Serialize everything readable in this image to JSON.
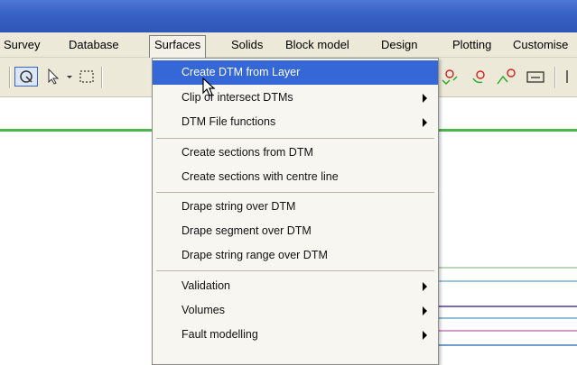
{
  "menubar": {
    "items": [
      "Survey",
      "Database",
      "Surfaces",
      "Solids",
      "Block model",
      "Design",
      "Plotting",
      "Customise"
    ],
    "active": "Surfaces"
  },
  "dropdown": {
    "items": [
      {
        "label": "Create DTM from Layer",
        "highlighted": true,
        "submenu": false
      },
      {
        "label": "Clip or intersect DTMs",
        "highlighted": false,
        "submenu": true
      },
      {
        "label": "DTM File functions",
        "highlighted": false,
        "submenu": true
      },
      {
        "label": "Create sections from DTM",
        "highlighted": false,
        "submenu": false
      },
      {
        "label": "Create sections with centre line",
        "highlighted": false,
        "submenu": false
      },
      {
        "label": "Drape string over DTM",
        "highlighted": false,
        "submenu": false
      },
      {
        "label": "Drape segment over DTM",
        "highlighted": false,
        "submenu": false
      },
      {
        "label": "Drape string range over DTM",
        "highlighted": false,
        "submenu": false
      },
      {
        "label": "Validation",
        "highlighted": false,
        "submenu": true
      },
      {
        "label": "Volumes",
        "highlighted": false,
        "submenu": true
      },
      {
        "label": "Fault modelling",
        "highlighted": false,
        "submenu": true
      }
    ]
  },
  "icons": {
    "toolbar": [
      "select-circle-icon",
      "pointer-icon",
      "rectangle-select-icon",
      "point-tools-icon",
      "circle-point-icon",
      "curve-point-icon",
      "window-icon"
    ]
  },
  "colors": {
    "titlebar": "#3a63c7",
    "highlight": "#3568d6",
    "menubar": "#ece9d8",
    "green_rule": "#4db54d"
  }
}
